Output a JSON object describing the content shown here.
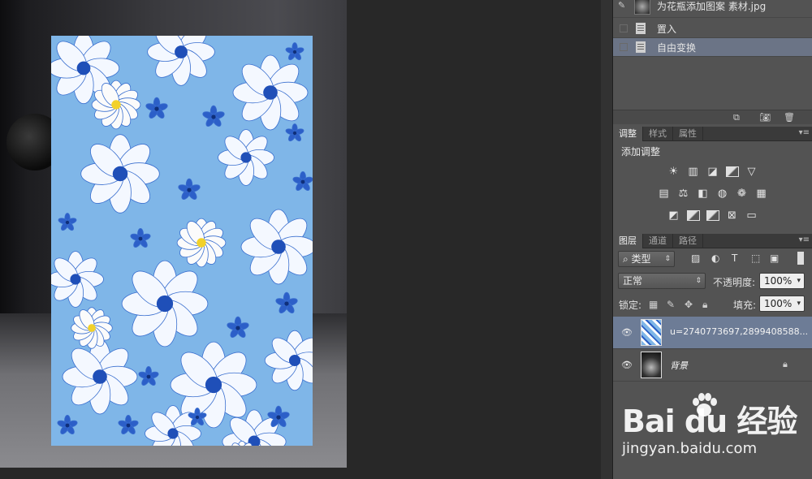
{
  "history": {
    "snapshot_label": "为花瓶添加图案 素材.jpg",
    "items": [
      {
        "label": "置入"
      },
      {
        "label": "自由变换"
      }
    ],
    "footer_icons": [
      "new-document-from-state-icon",
      "camera-icon",
      "trash-icon"
    ]
  },
  "adjustments": {
    "tabs": [
      "调整",
      "样式",
      "属性"
    ],
    "title": "添加调整",
    "icons": [
      [
        "brightness-contrast-icon",
        "levels-icon",
        "curves-icon",
        "exposure-icon",
        "vibrance-icon"
      ],
      [
        "hue-saturation-icon",
        "color-balance-icon",
        "black-white-icon",
        "photo-filter-icon",
        "channel-mixer-icon",
        "color-lookup-icon"
      ],
      [
        "invert-icon",
        "posterize-icon",
        "threshold-icon",
        "selective-color-icon",
        "gradient-map-icon"
      ]
    ]
  },
  "layers": {
    "tabs": [
      "图层",
      "通道",
      "路径"
    ],
    "filter_kind": "类型",
    "blend_mode": "正常",
    "opacity_label": "不透明度:",
    "opacity_value": "100%",
    "lock_label": "锁定:",
    "fill_label": "填充:",
    "fill_value": "100%",
    "items": [
      {
        "name": "u=2740773697,2899408588...",
        "selected": true,
        "visible": true
      },
      {
        "name": "背景",
        "selected": false,
        "visible": true,
        "locked": true
      }
    ]
  },
  "watermark": {
    "logo_text": "Bai du 经验",
    "url": "jingyan.baidu.com"
  },
  "colors": {
    "panel_bg": "#535353",
    "selected_row": "#6d7c96",
    "pattern_sky": "#7fb6e8",
    "pattern_blue": "#1f4fb8",
    "pattern_yellow": "#f2d12a"
  }
}
